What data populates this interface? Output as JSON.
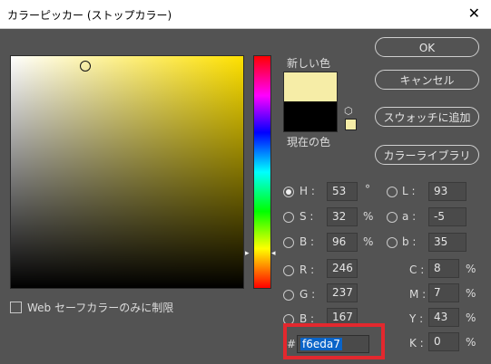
{
  "window": {
    "title": "カラーピッカー (ストップカラー)",
    "close_glyph": "✕"
  },
  "preview": {
    "new_label": "新しい色",
    "current_label": "現在の色",
    "new_color": "#f6eda7",
    "current_color": "#000000"
  },
  "buttons": {
    "ok": "OK",
    "cancel": "キャンセル",
    "add_swatch": "スウォッチに追加",
    "libraries": "カラーライブラリ"
  },
  "hsb": {
    "h": {
      "label": "H :",
      "value": "53",
      "unit": "°"
    },
    "s": {
      "label": "S :",
      "value": "32",
      "unit": "%"
    },
    "b": {
      "label": "B :",
      "value": "96",
      "unit": "%"
    }
  },
  "lab": {
    "l": {
      "label": "L :",
      "value": "93"
    },
    "a": {
      "label": "a :",
      "value": "-5"
    },
    "b": {
      "label": "b :",
      "value": "35"
    }
  },
  "rgb": {
    "r": {
      "label": "R :",
      "value": "246"
    },
    "g": {
      "label": "G :",
      "value": "237"
    },
    "b": {
      "label": "B :",
      "value": "167"
    }
  },
  "cmyk": {
    "c": {
      "label": "C :",
      "value": "8",
      "unit": "%"
    },
    "m": {
      "label": "M :",
      "value": "7",
      "unit": "%"
    },
    "y": {
      "label": "Y :",
      "value": "43",
      "unit": "%"
    },
    "k": {
      "label": "K :",
      "value": "0",
      "unit": "%"
    }
  },
  "hex": {
    "prefix": "#",
    "value": "f6eda7"
  },
  "websafe": {
    "label": "Web セーフカラーのみに制限",
    "checked": false
  },
  "icons": {
    "cube": "web-safe-cube-icon",
    "slider_left": "▸",
    "slider_right": "◂"
  },
  "accent": {
    "highlight": "#e3282e"
  }
}
